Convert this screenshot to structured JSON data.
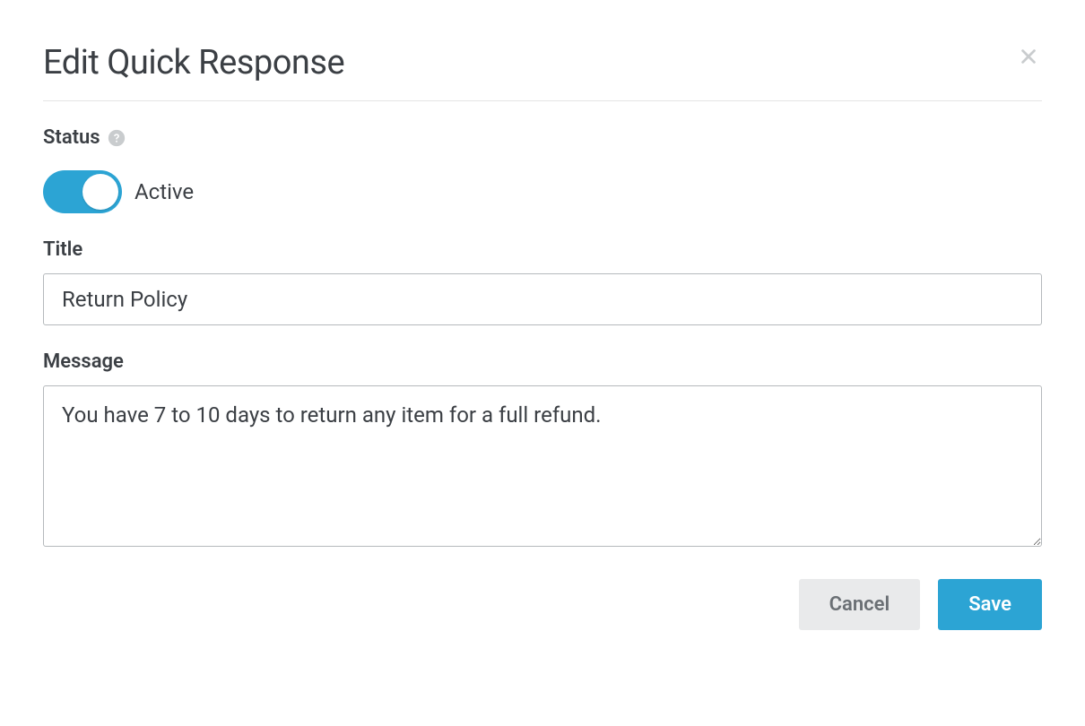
{
  "modal": {
    "title": "Edit Quick Response"
  },
  "status": {
    "label": "Status",
    "toggle_state": "Active"
  },
  "title_field": {
    "label": "Title",
    "value": "Return Policy"
  },
  "message_field": {
    "label": "Message",
    "value": "You have 7 to 10 days to return any item for a full refund."
  },
  "buttons": {
    "cancel": "Cancel",
    "save": "Save"
  }
}
